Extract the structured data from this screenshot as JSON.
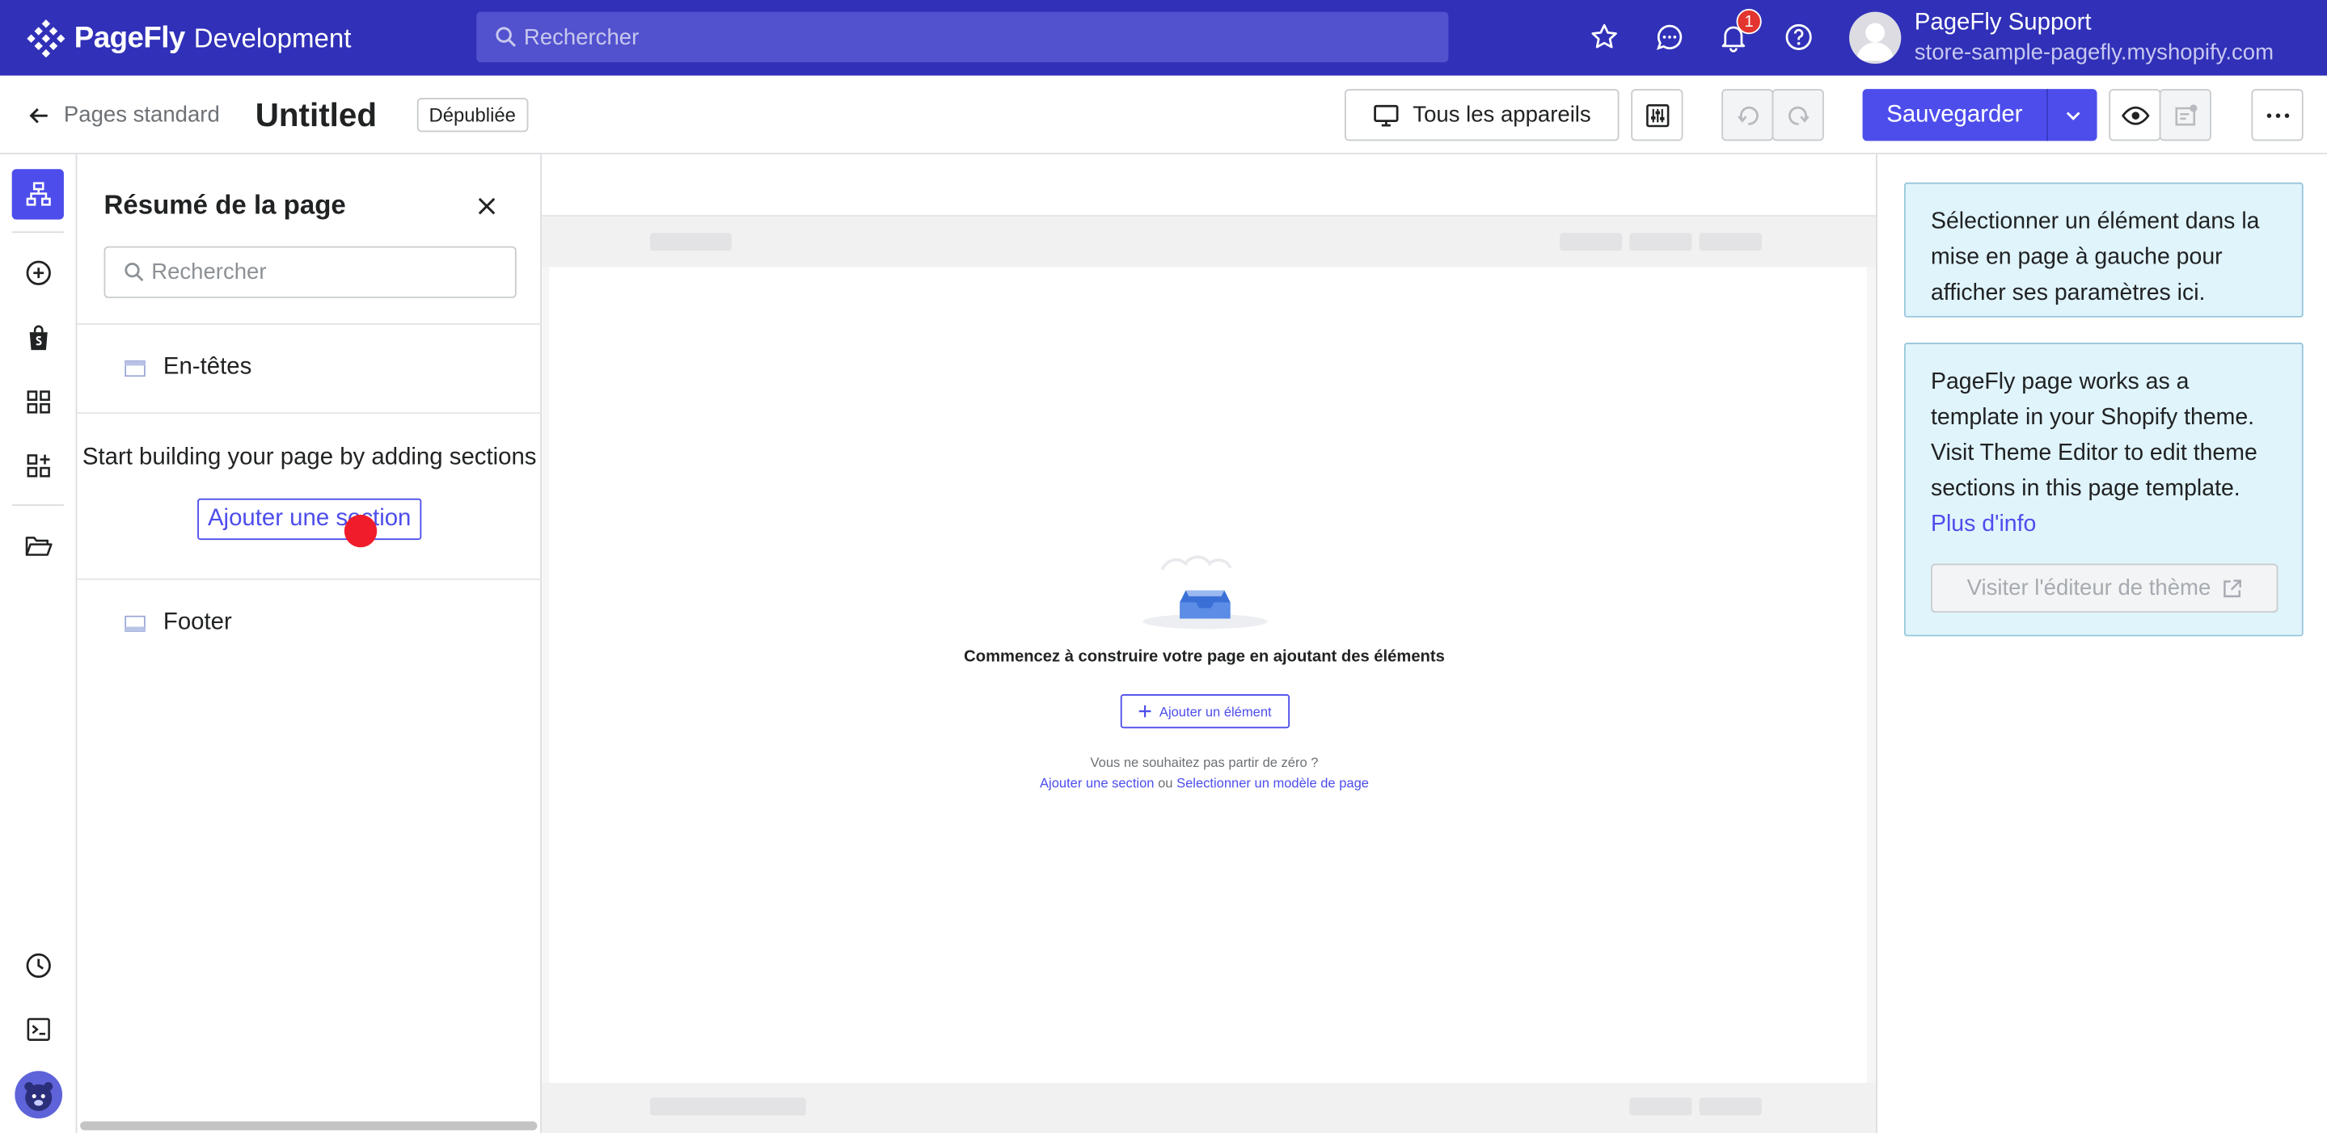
{
  "topbar": {
    "brand": "PageFly",
    "brand_suffix": "Development",
    "search_placeholder": "Rechercher",
    "notification_count": "1",
    "user_name": "PageFly Support",
    "user_store": "store-sample-pagefly.myshopify.com"
  },
  "toolbar": {
    "back_label": "Pages standard",
    "page_title": "Untitled",
    "status": "Dépubliée",
    "devices_label": "Tous les appareils",
    "save_label": "Sauvegarder"
  },
  "outline": {
    "title": "Résumé de la page",
    "search_placeholder": "Rechercher",
    "header_label": "En-têtes",
    "empty_text": "Start building your page by adding sections",
    "add_section_label": "Ajouter une section",
    "footer_label": "Footer"
  },
  "canvas": {
    "empty_title": "Commencez à construire votre page en ajoutant des éléments",
    "add_element_label": "Ajouter un élément",
    "question": "Vous ne souhaitez pas partir de zéro ?",
    "link_section": "Ajouter une section",
    "or_text": "ou",
    "link_template": "Selectionner un modèle de page"
  },
  "sidebar": {
    "select_hint": "Sélectionner un élément dans la mise en page à gauche pour afficher ses paramètres ici.",
    "theme_info": "PageFly page works as a template in your Shopify theme. Visit Theme Editor to edit theme sections in this page template.",
    "more_info_link": "Plus d'info",
    "visit_button": "Visiter l'éditeur de thème"
  },
  "colors": {
    "topbar": "#3030b8",
    "accent": "#4d4dec",
    "info_bg": "#e0f4fc",
    "cursor": "#f01b2b"
  }
}
